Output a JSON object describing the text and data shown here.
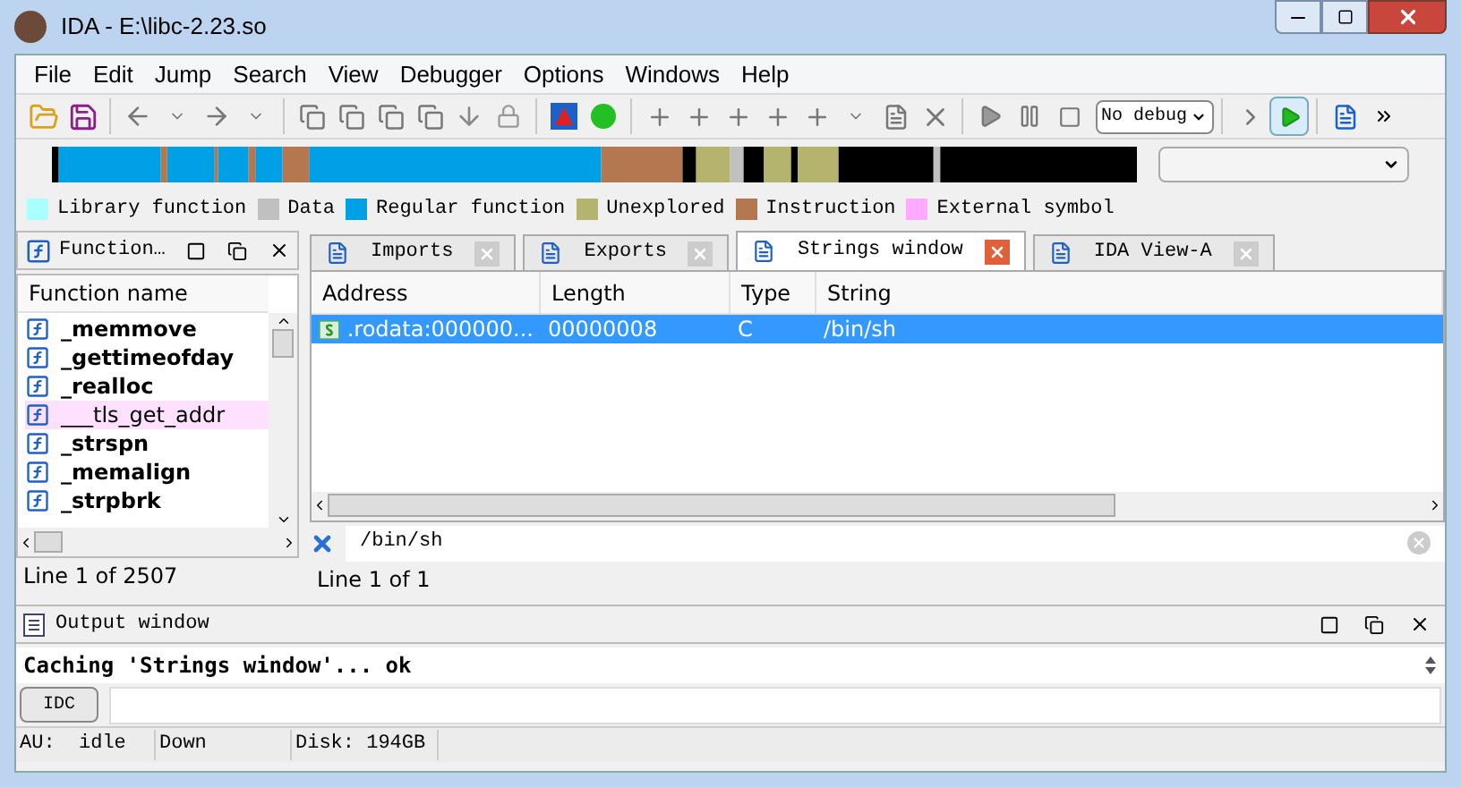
{
  "window": {
    "title": "IDA - E:\\libc-2.23.so"
  },
  "menu": [
    "File",
    "Edit",
    "Jump",
    "Search",
    "View",
    "Debugger",
    "Options",
    "Windows",
    "Help"
  ],
  "debugger_select": {
    "value": "No debug"
  },
  "legend": [
    {
      "label": "Library function",
      "color": "#aaffff"
    },
    {
      "label": "Data",
      "color": "#c0c0c0"
    },
    {
      "label": "Regular function",
      "color": "#00a0e6"
    },
    {
      "label": "Unexplored",
      "color": "#b4b46e"
    },
    {
      "label": "Instruction",
      "color": "#b47850"
    },
    {
      "label": "External symbol",
      "color": "#ffaaff"
    }
  ],
  "functions_panel": {
    "title": "Function…",
    "column": "Function name",
    "status": "Line 1 of 2507",
    "items": [
      {
        "name": "_memmove",
        "kind": "regular"
      },
      {
        "name": "_gettimeofday",
        "kind": "regular"
      },
      {
        "name": "_realloc",
        "kind": "regular"
      },
      {
        "name": "___tls_get_addr",
        "kind": "external"
      },
      {
        "name": "_strspn",
        "kind": "regular"
      },
      {
        "name": "_memalign",
        "kind": "regular"
      },
      {
        "name": "_strpbrk",
        "kind": "regular"
      }
    ]
  },
  "tabs": [
    {
      "label": "Imports",
      "selected": false
    },
    {
      "label": "Exports",
      "selected": false
    },
    {
      "label": "Strings window",
      "selected": true
    },
    {
      "label": "IDA View-A",
      "selected": false
    }
  ],
  "strings_table": {
    "columns": [
      "Address",
      "Length",
      "Type",
      "String"
    ],
    "rows": [
      {
        "cells": [
          ".rodata:000000...",
          "00000008",
          "C",
          "/bin/sh"
        ],
        "selected": true
      }
    ]
  },
  "filter": {
    "value": "/bin/sh"
  },
  "strings_status": "Line 1 of 1",
  "output_window": {
    "title": "Output window",
    "lines": [
      "Caching 'Strings window'... ok"
    ]
  },
  "command": {
    "button": "IDC"
  },
  "status_bar": [
    "AU:  idle",
    "Down",
    "Disk: 194GB"
  ]
}
